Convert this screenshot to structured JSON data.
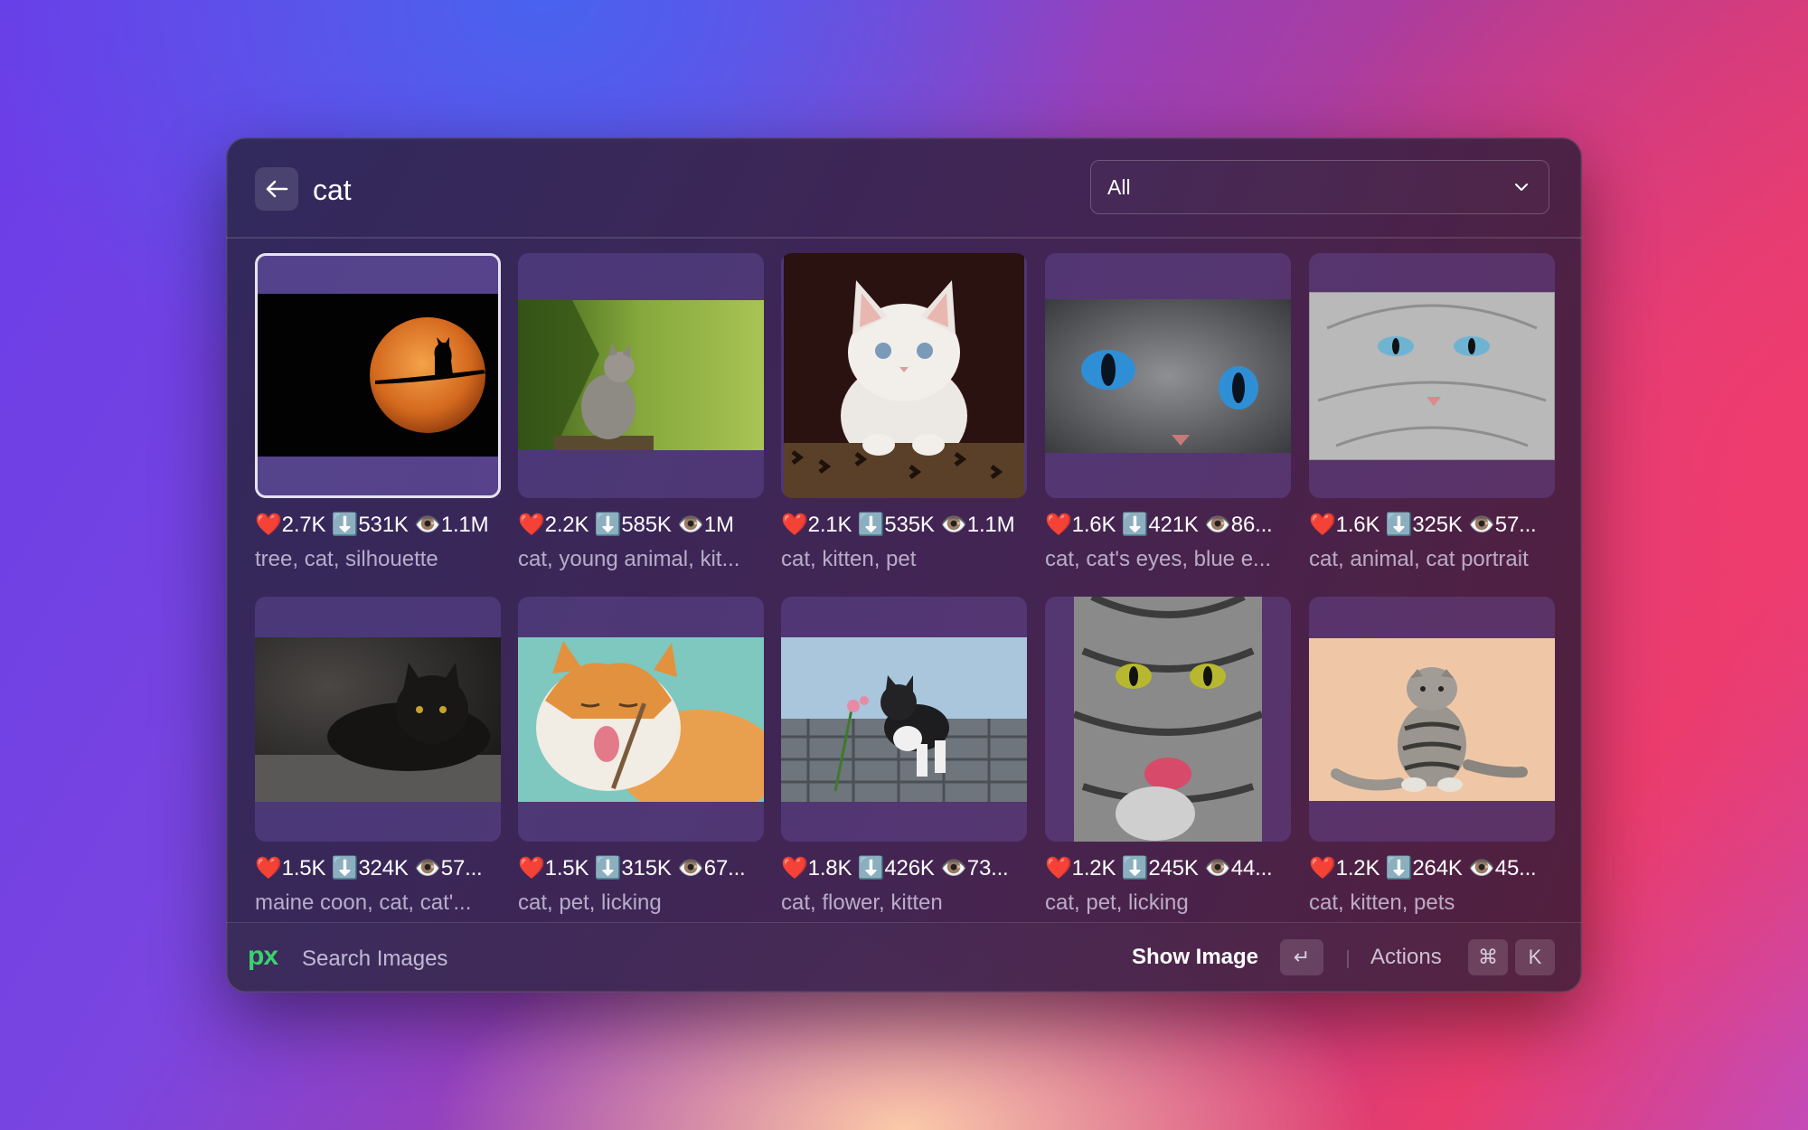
{
  "search": {
    "query": "cat"
  },
  "filter": {
    "selected": "All"
  },
  "results": [
    {
      "stats": "❤️2.7K ⬇️531K 👁️1.1M",
      "tags": "tree, cat, silhouette"
    },
    {
      "stats": "❤️2.2K ⬇️585K 👁️1M",
      "tags": "cat, young animal, kit..."
    },
    {
      "stats": "❤️2.1K ⬇️535K 👁️1.1M",
      "tags": "cat, kitten, pet"
    },
    {
      "stats": "❤️1.6K ⬇️421K 👁️86...",
      "tags": "cat, cat's eyes, blue e..."
    },
    {
      "stats": "❤️1.6K ⬇️325K 👁️57...",
      "tags": "cat, animal, cat portrait"
    },
    {
      "stats": "❤️1.5K ⬇️324K 👁️57...",
      "tags": "maine coon, cat, cat'..."
    },
    {
      "stats": "❤️1.5K ⬇️315K 👁️67...",
      "tags": "cat, pet, licking"
    },
    {
      "stats": "❤️1.8K ⬇️426K 👁️73...",
      "tags": "cat, flower, kitten"
    },
    {
      "stats": "❤️1.2K ⬇️245K 👁️44...",
      "tags": "cat, pet, licking"
    },
    {
      "stats": "❤️1.2K ⬇️264K 👁️45...",
      "tags": "cat, kitten, pets"
    }
  ],
  "footer": {
    "logo": "px",
    "title": "Search Images",
    "primary_action": "Show Image",
    "primary_key": "↵",
    "actions_label": "Actions",
    "actions_keys": [
      "⌘",
      "K"
    ]
  }
}
